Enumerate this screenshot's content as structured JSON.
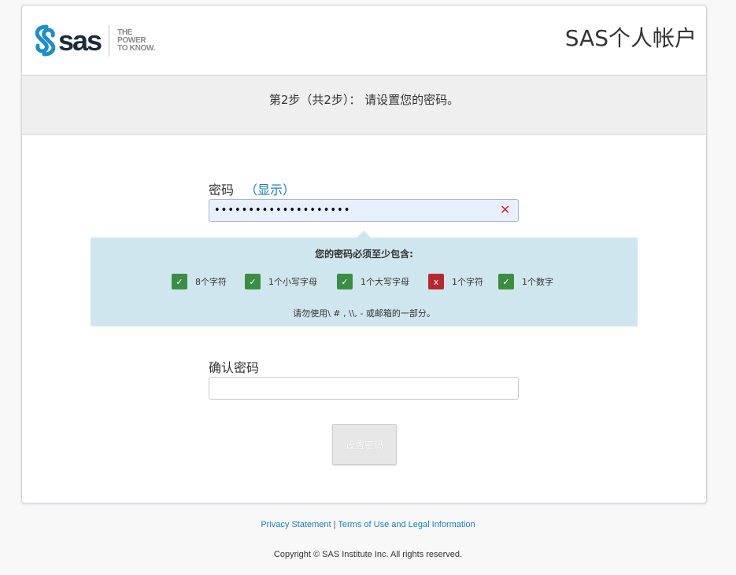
{
  "header": {
    "logo_text": "sas",
    "tagline": [
      "THE",
      "POWER",
      "TO KNOW."
    ],
    "title": "SAS个人帐户"
  },
  "step": {
    "text": "第2步（共2步）： 请设置您的密码。"
  },
  "password": {
    "label": "密码",
    "show_link": "（显示）",
    "value": "••••••••••••••••••••",
    "clear_icon": "close-icon"
  },
  "requirements": {
    "title": "您的密码必须至少包含:",
    "items": [
      {
        "label": "8个字符",
        "met": true
      },
      {
        "label": "1个小写字母",
        "met": true
      },
      {
        "label": "1个大写字母",
        "met": true
      },
      {
        "label": "1个字符",
        "met": false
      },
      {
        "label": "1个数字",
        "met": true
      }
    ],
    "check_glyph": "✓",
    "fail_glyph": "x",
    "note": "请勿使用\\ # ,  \\\\,  - 或邮箱的一部分。"
  },
  "confirm": {
    "label": "确认密码",
    "value": ""
  },
  "submit": {
    "label": "设置密码"
  },
  "footer": {
    "privacy": "Privacy Statement",
    "separator": "|",
    "terms": "Terms of Use and Legal Information",
    "copyright": "Copyright © SAS Institute Inc. All rights reserved."
  },
  "colors": {
    "link": "#1a7fb6",
    "ok": "#3c8d44",
    "fail": "#b52a2f",
    "rules_bg": "#d0e6ee"
  }
}
